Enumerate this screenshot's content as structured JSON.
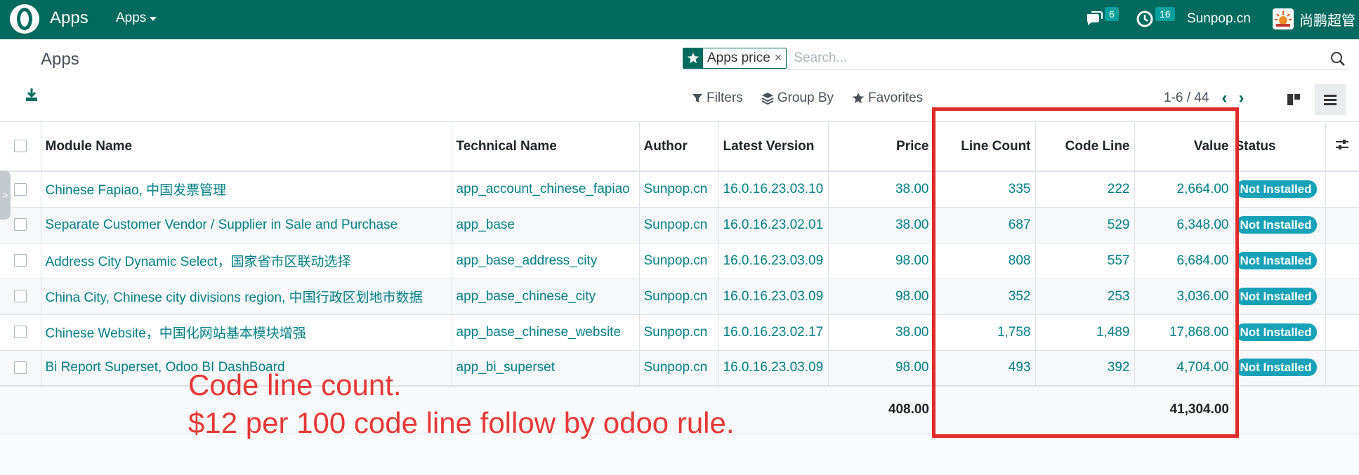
{
  "nav": {
    "app_title": "Apps",
    "menu_label": "Apps",
    "messages_count": "6",
    "activities_count": "16",
    "company": "Sunpop.cn",
    "user": "尚鹏超管"
  },
  "control": {
    "breadcrumb": "Apps",
    "facet_label": "Apps price",
    "facet_close": "×",
    "search_placeholder": "Search...",
    "filters_label": "Filters",
    "groupby_label": "Group By",
    "favorites_label": "Favorites",
    "pager_value": "1-6 / 44"
  },
  "table": {
    "headers": [
      "Module Name",
      "Technical Name",
      "Author",
      "Latest Version",
      "Price",
      "Line Count",
      "Code Line",
      "Value",
      "Status"
    ],
    "rows": [
      [
        "Chinese Fapiao, 中国发票管理",
        "app_account_chinese_fapiao",
        "Sunpop.cn",
        "16.0.16.23.03.10",
        "38.00",
        "335",
        "222",
        "2,664.00",
        "Not Installed"
      ],
      [
        "Separate Customer Vendor / Supplier in Sale and Purchase",
        "app_base",
        "Sunpop.cn",
        "16.0.16.23.02.01",
        "38.00",
        "687",
        "529",
        "6,348.00",
        "Not Installed"
      ],
      [
        "Address City Dynamic Select，国家省市区联动选择",
        "app_base_address_city",
        "Sunpop.cn",
        "16.0.16.23.03.09",
        "98.00",
        "808",
        "557",
        "6,684.00",
        "Not Installed"
      ],
      [
        "China City, Chinese city divisions region, 中国行政区划地市数据",
        "app_base_chinese_city",
        "Sunpop.cn",
        "16.0.16.23.03.09",
        "98.00",
        "352",
        "253",
        "3,036.00",
        "Not Installed"
      ],
      [
        "Chinese Website，中国化网站基本模块增强",
        "app_base_chinese_website",
        "Sunpop.cn",
        "16.0.16.23.02.17",
        "38.00",
        "1,758",
        "1,489",
        "17,868.00",
        "Not Installed"
      ],
      [
        "Bi Report Superset, Odoo BI DashBoard",
        "app_bi_superset",
        "Sunpop.cn",
        "16.0.16.23.03.09",
        "98.00",
        "493",
        "392",
        "4,704.00",
        "Not Installed"
      ]
    ],
    "total_price": "408.00",
    "total_value": "41,304.00"
  },
  "annotation": {
    "line1": "Code line count.",
    "line2": "$12 per 100 code line follow by odoo rule."
  },
  "colors": {
    "brand": "#016a5e",
    "link": "#017e84",
    "status": "#17a2b8",
    "annotation": "#e02a2a"
  }
}
